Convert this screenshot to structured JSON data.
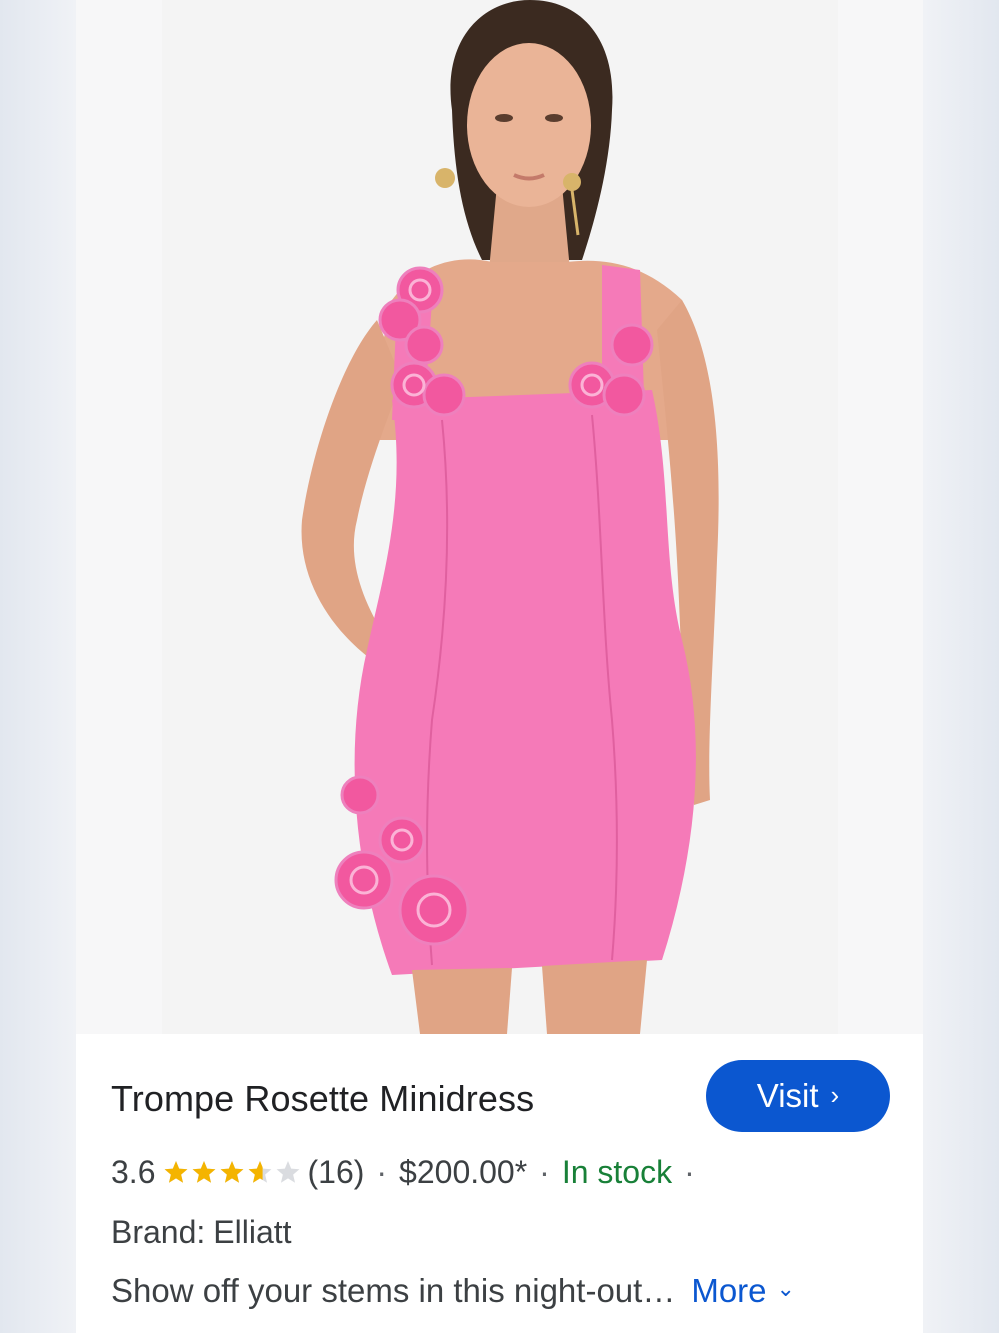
{
  "product": {
    "title": "Trompe Rosette Minidress",
    "visit_label": "Visit",
    "rating": "3.6",
    "rating_value": 3.6,
    "rating_max": 5,
    "review_count": "(16)",
    "price": "$200.00*",
    "stock": "In stock",
    "separator": "·",
    "brand_label": "Brand:",
    "brand_value": "Elliatt",
    "description": "Show off your stems in this night-out…",
    "more_label": "More"
  },
  "icons": {
    "visit": "chevron-right-icon",
    "more": "chevron-down-icon",
    "rating": "star-icon"
  },
  "colors": {
    "accent": "#0b57d0",
    "stock": "#188038",
    "star": "#f4b400",
    "star_empty": "#dadce0",
    "dress": "#f57ab8"
  }
}
